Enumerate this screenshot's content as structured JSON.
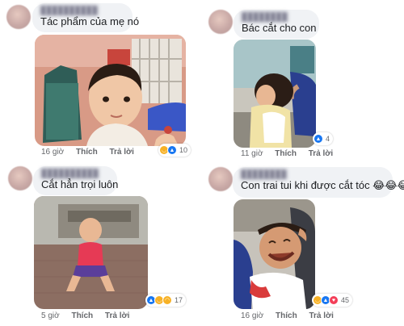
{
  "comments": [
    {
      "text": "Tác phẩm của mẹ nó",
      "time": "16 giờ",
      "like": "Thích",
      "reply": "Trả lời",
      "reaction_icons": [
        "like-icon",
        "haha-icon"
      ],
      "reaction_count": "10"
    },
    {
      "text": "Bác cắt cho con",
      "time": "11 giờ",
      "like": "Thích",
      "reply": "Trả lời",
      "reaction_icons": [
        "like-icon"
      ],
      "reaction_count": "4"
    },
    {
      "text": "Cắt hẳn trọi luôn",
      "time": "5 giờ",
      "like": "Thích",
      "reply": "Trả lời",
      "reaction_icons": [
        "like-icon",
        "haha-icon",
        "sad-icon"
      ],
      "reaction_count": "17"
    },
    {
      "text": "Con trai tui khi được cắt tóc 😂😂😂",
      "time": "16 giờ",
      "like": "Thích",
      "reply": "Trả lời",
      "reaction_icons": [
        "haha-icon",
        "like-icon",
        "love-icon"
      ],
      "reaction_count": "45"
    }
  ],
  "colors": {
    "bubble": "#f0f2f5",
    "like_blue": "#1877f2",
    "haha_yellow": "#f7b125",
    "love_red": "#f33e58",
    "meta_gray": "#65676b"
  }
}
